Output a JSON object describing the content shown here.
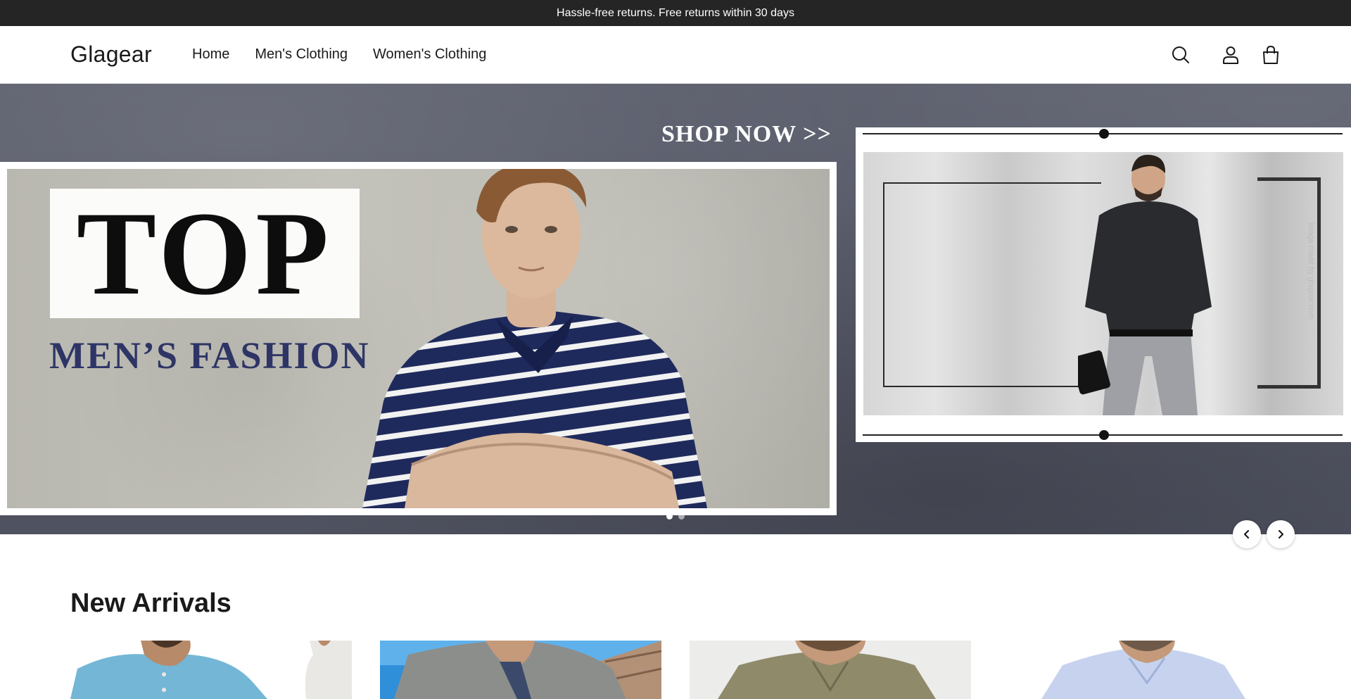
{
  "announcement": "Hassle-free returns. Free returns within 30 days",
  "brand": "Glagear",
  "nav": [
    "Home",
    "Men's Clothing",
    "Women's Clothing"
  ],
  "header_icons": [
    "search-icon",
    "account-icon",
    "cart-icon"
  ],
  "hero": {
    "shop_now": "SHOP NOW >>",
    "main_slide": {
      "headline": "TOP",
      "subheadline": "MEN’S FASHION"
    },
    "side_slide": {
      "credit": "image credit by glagear.com"
    },
    "dots": 2,
    "active_dot": 0
  },
  "carousel_arrows": {
    "prev": "chevron-left-icon",
    "next": "chevron-right-icon"
  },
  "section": {
    "title": "New Arrivals"
  },
  "products": [
    {
      "name": "light-blue-band-collar-shirt"
    },
    {
      "name": "grey-patterned-shirt-beach"
    },
    {
      "name": "khaki-casual-shirt"
    },
    {
      "name": "light-blue-dress-shirt"
    }
  ],
  "colors": {
    "announce_bg": "#252525",
    "hero_bg": "#585b69",
    "fashion_text": "#2e3566"
  }
}
